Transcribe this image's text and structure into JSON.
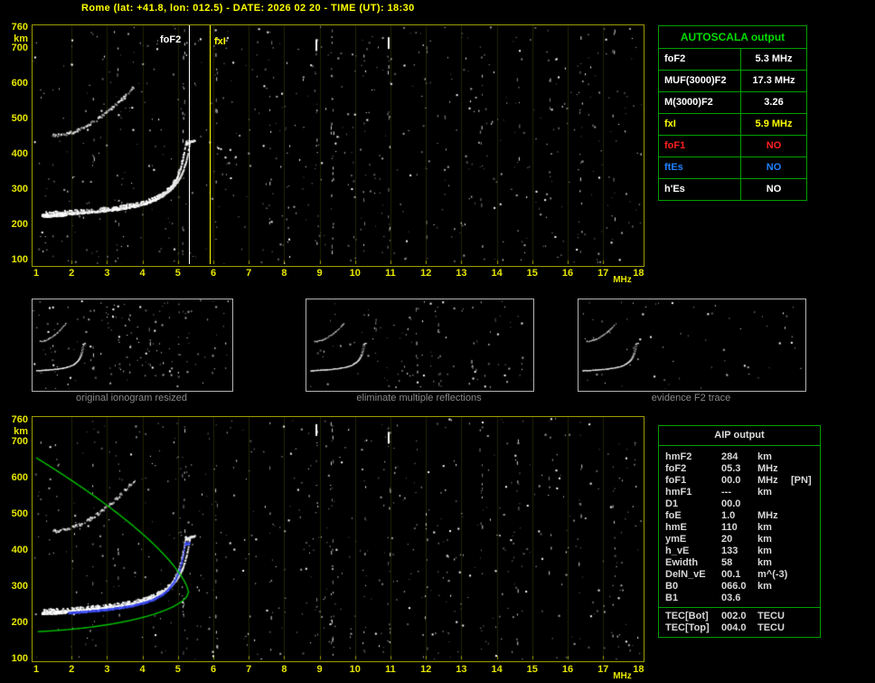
{
  "title": "Rome (lat: +41.8, lon: 012.5) - DATE: 2026 02 20 - TIME (UT): 18:30",
  "axis": {
    "y_unit": "km",
    "x_unit": "MHz",
    "y_ticks": [
      "760",
      "700",
      "600",
      "500",
      "400",
      "300",
      "200",
      "100"
    ],
    "x_ticks": [
      "1",
      "2",
      "3",
      "4",
      "5",
      "6",
      "7",
      "8",
      "9",
      "10",
      "11",
      "12",
      "13",
      "14",
      "15",
      "16",
      "17",
      "18"
    ]
  },
  "markers": {
    "foF2": {
      "label": "foF2",
      "freq": 5.3,
      "color": "#ffffff"
    },
    "fxI": {
      "label": "fxI",
      "freq": 5.9,
      "color": "#ffff00"
    }
  },
  "autoscala": {
    "header": "AUTOSCALA output",
    "rows": [
      {
        "label": "foF2",
        "value": "5.3 MHz",
        "color": "#ffffff"
      },
      {
        "label": "MUF(3000)F2",
        "value": "17.3 MHz",
        "color": "#ffffff"
      },
      {
        "label": "M(3000)F2",
        "value": "3.26",
        "color": "#ffffff"
      },
      {
        "label": "fxI",
        "value": "5.9 MHz",
        "color": "#ffff00"
      },
      {
        "label": "foF1",
        "value": "NO",
        "color": "#ff2020"
      },
      {
        "label": "ftEs",
        "value": "NO",
        "color": "#2080ff"
      },
      {
        "label": "h'Es",
        "value": "NO",
        "color": "#ffffff"
      }
    ]
  },
  "thumbnails": [
    {
      "caption": "original ionogram resized"
    },
    {
      "caption": "eliminate multiple reflections"
    },
    {
      "caption": "evidence F2 trace"
    }
  ],
  "aip": {
    "header": "AIP output",
    "rows": [
      {
        "label": "hmF2",
        "value": "284",
        "unit": "km",
        "extra": ""
      },
      {
        "label": "foF2",
        "value": "05.3",
        "unit": "MHz",
        "extra": ""
      },
      {
        "label": "foF1",
        "value": "00.0",
        "unit": "MHz",
        "extra": "[PN]"
      },
      {
        "label": "hmF1",
        "value": "---",
        "unit": "km",
        "extra": ""
      },
      {
        "label": "D1",
        "value": "00.0",
        "unit": "",
        "extra": ""
      },
      {
        "label": "foE",
        "value": "1.0",
        "unit": "MHz",
        "extra": ""
      },
      {
        "label": "hmE",
        "value": "110",
        "unit": "km",
        "extra": ""
      },
      {
        "label": "ymE",
        "value": "20",
        "unit": "km",
        "extra": ""
      },
      {
        "label": "h_vE",
        "value": "133",
        "unit": "km",
        "extra": ""
      },
      {
        "label": "Ewidth",
        "value": "58",
        "unit": "km",
        "extra": ""
      },
      {
        "label": "DelN_vE",
        "value": "00.1",
        "unit": "m^(-3)",
        "extra": ""
      },
      {
        "label": "B0",
        "value": "066.0",
        "unit": "km",
        "extra": ""
      },
      {
        "label": "B1",
        "value": "03.6",
        "unit": "",
        "extra": ""
      }
    ],
    "tec_rows": [
      {
        "label": "TEC[Bot]",
        "value": "002.0",
        "unit": "TECU"
      },
      {
        "label": "TEC[Top]",
        "value": "004.0",
        "unit": "TECU"
      }
    ]
  },
  "chart_data": {
    "type": "scatter",
    "title": "Ionogram: virtual height vs sounding frequency",
    "xlabel": "MHz",
    "ylabel": "km",
    "xlim": [
      1,
      18
    ],
    "ylim": [
      100,
      760
    ],
    "foF2_MHz": 5.3,
    "fxI_MHz": 5.9,
    "MUF3000F2_MHz": 17.3,
    "M3000F2": 3.26,
    "f2_trace": [
      [
        1.2,
        229
      ],
      [
        2,
        234
      ],
      [
        3,
        243
      ],
      [
        4,
        260
      ],
      [
        4.5,
        281
      ],
      [
        5,
        345
      ],
      [
        5.2,
        415
      ],
      [
        5.3,
        428
      ]
    ],
    "second_hop_trace": [
      [
        1.5,
        455
      ],
      [
        2.5,
        489
      ],
      [
        3,
        525
      ],
      [
        3.7,
        595
      ]
    ],
    "reconstructed_trace_color": "#4a5aff",
    "profile": {
      "hmF2_km": 284,
      "foF2_MHz": 5.3,
      "topside": [
        [
          1,
          655
        ],
        [
          3,
          525
        ],
        [
          5.3,
          284
        ]
      ],
      "bottomside": [
        [
          1,
          174
        ],
        [
          4,
          228
        ],
        [
          5.3,
          284
        ]
      ],
      "color": "#00c400"
    }
  }
}
